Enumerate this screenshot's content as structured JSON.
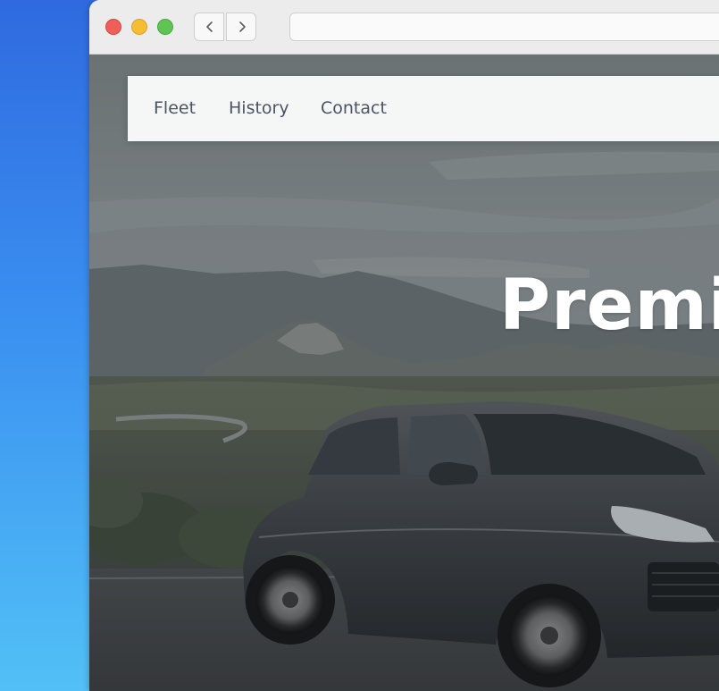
{
  "browser": {
    "address_value": "",
    "controls": {
      "close": "close-button",
      "minimize": "minimize-button",
      "zoom": "zoom-button",
      "back_icon": "chevron-left-icon",
      "forward_icon": "chevron-right-icon"
    }
  },
  "site": {
    "nav": {
      "items": [
        {
          "label": "Fleet"
        },
        {
          "label": "History"
        },
        {
          "label": "Contact"
        }
      ]
    },
    "hero": {
      "title": "Premi",
      "image": "dark-grey-suv-on-mountain-road"
    }
  },
  "colors": {
    "desktop_top": "#2f6ae0",
    "desktop_bottom": "#52c0f6",
    "traffic_red": "#ee5f59",
    "traffic_yellow": "#f5bd33",
    "traffic_green": "#5fc453",
    "nav_text": "#4a5463",
    "hero_text": "#ffffff"
  }
}
